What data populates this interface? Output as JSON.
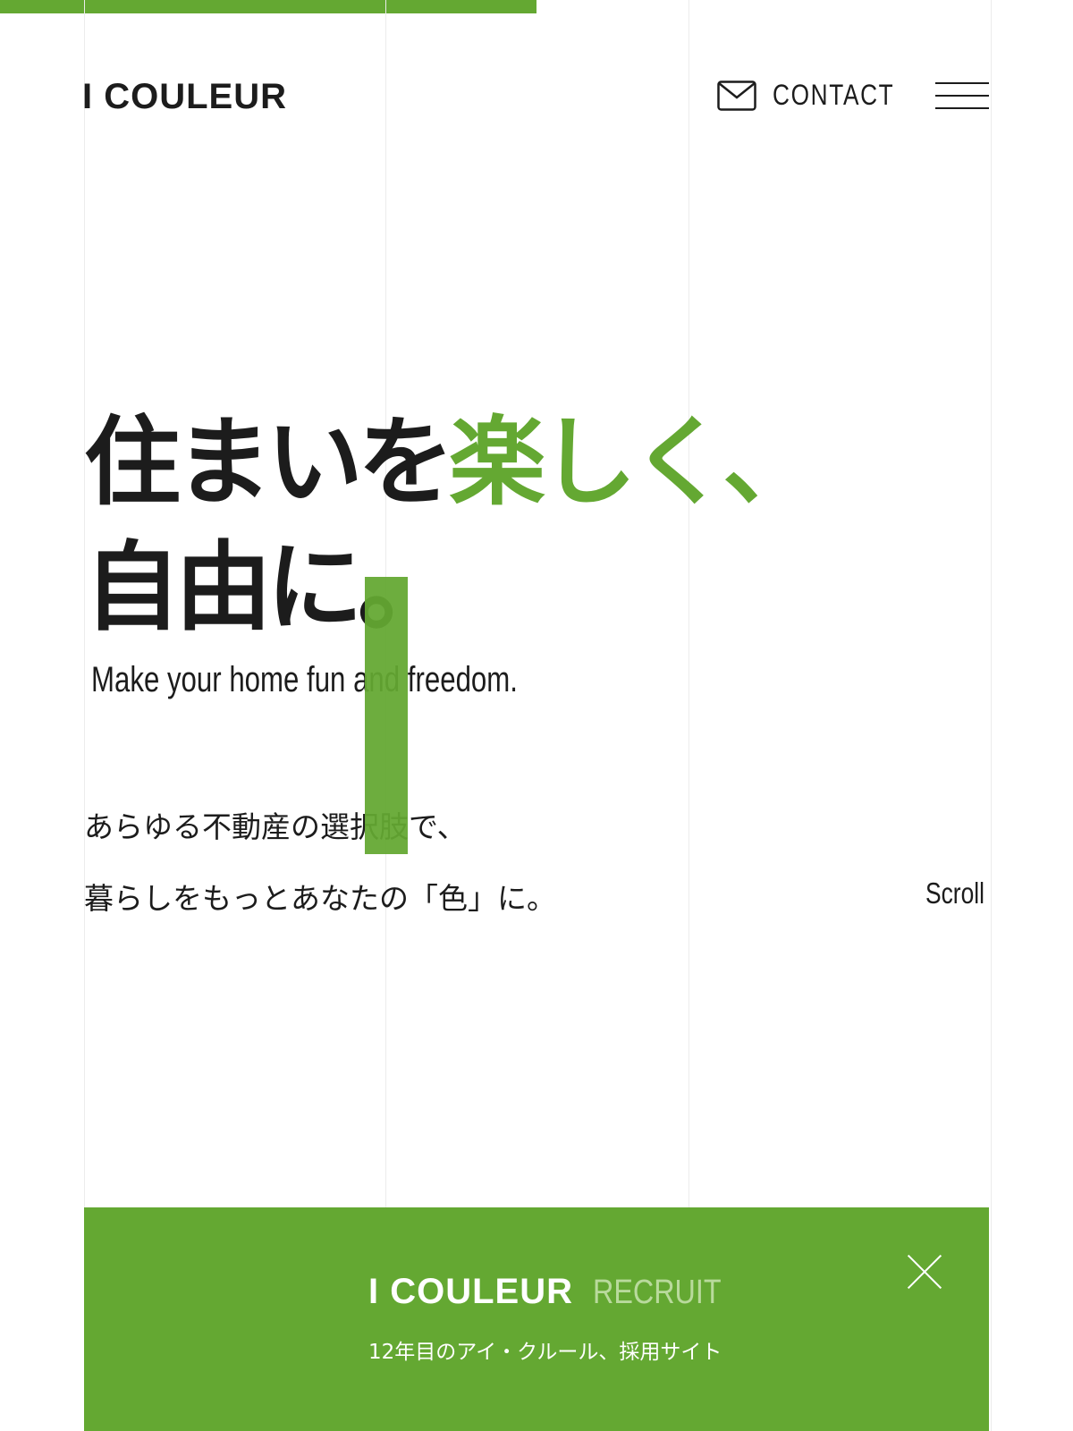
{
  "header": {
    "logo": "I COULEUR",
    "contact_label": "CONTACT",
    "contact_icon": "mail-icon",
    "menu_icon": "hamburger-menu-icon"
  },
  "hero": {
    "headline_line1_dark": "住まいを",
    "headline_line1_accent": "楽しく、",
    "headline_line2": "自由に。",
    "subtitle_en": "Make your home fun and freedom.",
    "body_line1": "あらゆる不動産の選択肢で、",
    "body_line2": "暮らしをもっとあなたの「色」に。",
    "scroll_label": "Scroll"
  },
  "banner": {
    "brand": "I COULEUR",
    "recruit": "RECRUIT",
    "subtitle": "12年目のアイ・クルール、採用サイト",
    "close_icon": "close-icon"
  },
  "colors": {
    "accent": "#64a832",
    "text": "#1c1c1c",
    "background": "#ffffff"
  }
}
